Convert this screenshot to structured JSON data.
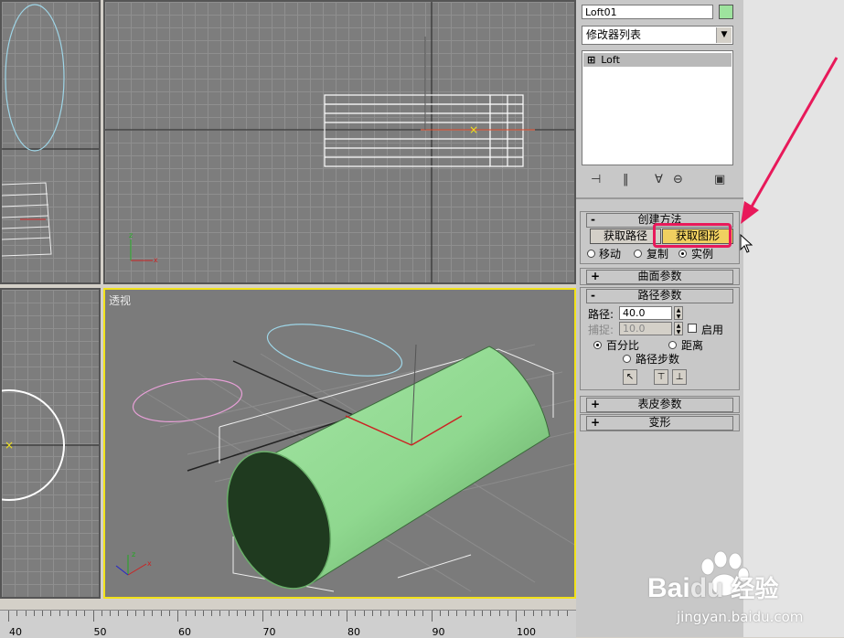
{
  "viewports": {
    "perspective_label": "透视"
  },
  "ruler": {
    "labels": [
      "40",
      "50",
      "60",
      "70",
      "80",
      "90",
      "100"
    ]
  },
  "panel": {
    "object_name": "Loft01",
    "object_color": "#9ee39e",
    "modifier_list": "修改器列表",
    "stack_items": [
      "Loft"
    ],
    "creation_method": {
      "title": "创建方法",
      "get_path": "获取路径",
      "get_shape": "获取图形",
      "move": "移动",
      "copy": "复制",
      "instance": "实例"
    },
    "surface_params": {
      "title": "曲面参数"
    },
    "path_params": {
      "title": "路径参数",
      "path_label": "路径:",
      "path_value": "40.0",
      "snap_label": "捕捉:",
      "snap_value": "10.0",
      "enable": "启用",
      "percentage": "百分比",
      "distance": "距离",
      "path_steps": "路径步数"
    },
    "skin_params": {
      "title": "表皮参数"
    },
    "deformation": {
      "title": "变形"
    }
  },
  "watermark": {
    "brand_a": "Bai",
    "brand_b": "du",
    "brand_cn": "经验",
    "url": "jingyan.baidu.com"
  },
  "colors": {
    "highlight": "#e8195a",
    "viewport_active": "#f2e21a",
    "loft_green": "#8fd88f"
  }
}
